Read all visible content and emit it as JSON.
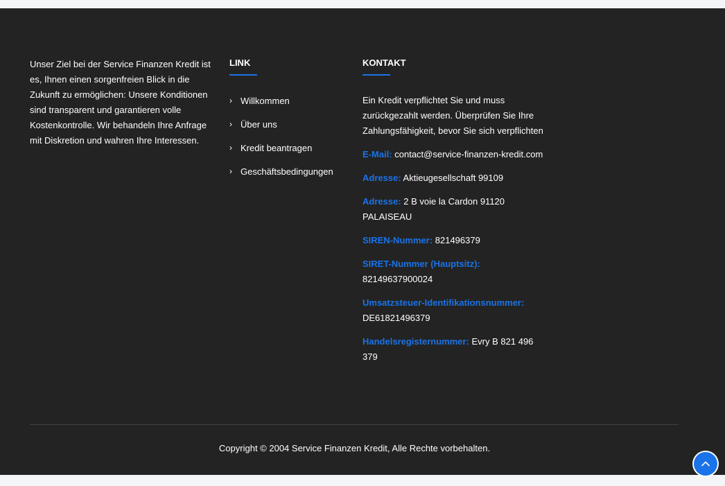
{
  "about": {
    "text": "Unser Ziel bei der Service Finanzen Kredit ist es, Ihnen einen sorgenfreien Blick in die Zukunft zu ermöglichen: Unsere Konditionen sind transparent und garantieren volle Kostenkontrolle. Wir behandeln Ihre Anfrage mit Diskretion und wahren Ihre Interessen."
  },
  "links": {
    "heading": "LINK",
    "items": [
      {
        "label": "Willkommen"
      },
      {
        "label": "Über uns"
      },
      {
        "label": "Kredit beantragen"
      },
      {
        "label": "Geschäftsbedingungen"
      }
    ]
  },
  "contact": {
    "heading": "KONTAKT",
    "intro": "Ein Kredit verpflichtet Sie und muss zurückgezahlt werden. Überprüfen Sie Ihre Zahlungsfähigkeit, bevor Sie sich verpflichten",
    "email_label": "E-Mail:",
    "email_value": "contact@service-finanzen-kredit.com",
    "address1_label": "Adresse:",
    "address1_value": "Aktieugesellschaft 99109",
    "address2_label": "Adresse:",
    "address2_value": "2 B voie la Cardon 91120 PALAISEAU",
    "siren_label": "SIREN-Nummer:",
    "siren_value": "821496379",
    "siret_label": "SIRET-Nummer (Hauptsitz):",
    "siret_value": "82149637900024",
    "vat_label": "Umsatzsteuer-Identifikationsnummer:",
    "vat_value": "DE61821496379",
    "register_label": "Handelsregisternummer:",
    "register_value": "Evry B 821 496 379"
  },
  "footer": {
    "copyright": "Copyright © 2004 Service Finanzen Kredit, Alle Rechte vorbehalten."
  },
  "icons": {
    "back_to_top": "chevron-up-icon",
    "link_bullet": "chevron-right-icon"
  },
  "colors": {
    "accent": "#1a73e8",
    "footer_bg": "#232323"
  }
}
